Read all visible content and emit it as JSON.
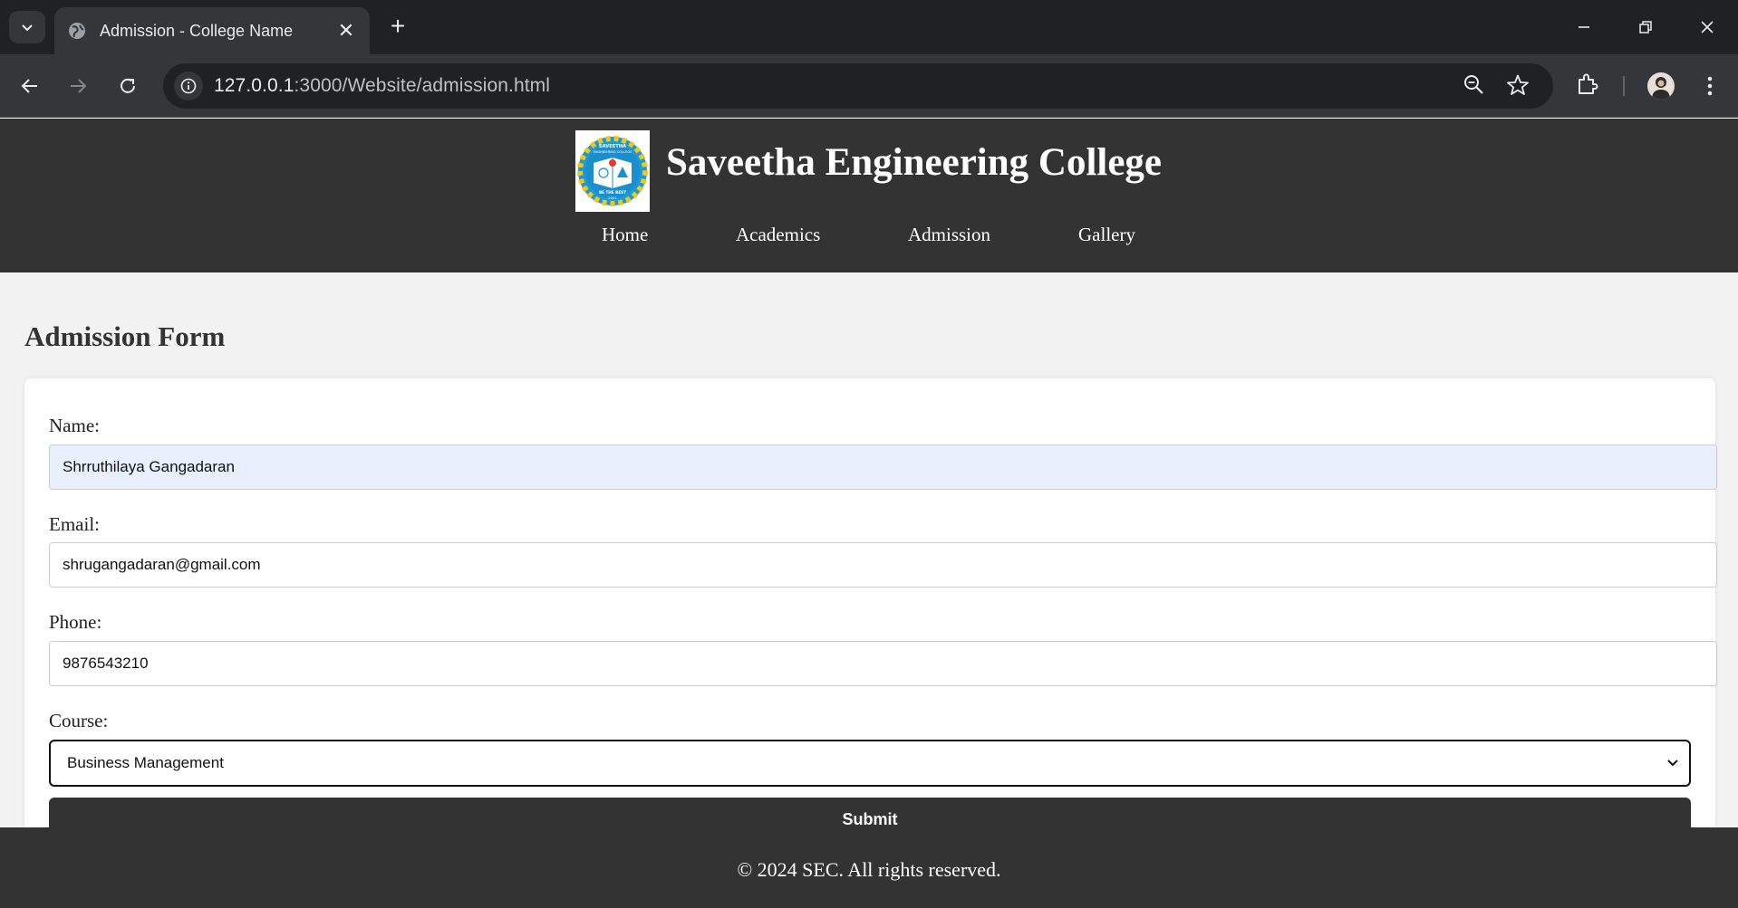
{
  "browser": {
    "tab_title": "Admission - College Name",
    "url_host": "127.0.0.1",
    "url_path": ":3000/Website/admission.html",
    "icons": [
      "tab-search-icon",
      "globe-icon",
      "close-icon",
      "new-tab-icon",
      "minimize-icon",
      "restore-icon",
      "window-close-icon",
      "back-icon",
      "forward-icon",
      "reload-icon",
      "site-info-icon",
      "zoom-icon",
      "bookmark-star-icon",
      "extensions-icon",
      "profile-avatar",
      "menu-kebab-icon"
    ],
    "new_tab_glyph": "+",
    "close_glyph": "✕"
  },
  "site": {
    "title": "Saveetha Engineering College",
    "logo": {
      "text_top": "SAVEETHA",
      "text_sub": "ENGINEERING COLLEGE",
      "motto": "BE THE BEST",
      "year": "2001"
    },
    "nav": [
      "Home",
      "Academics",
      "Admission",
      "Gallery"
    ]
  },
  "form": {
    "heading": "Admission Form",
    "name_label": "Name:",
    "name_value": "Shrruthilaya Gangadaran",
    "email_label": "Email:",
    "email_value": "shrugangadaran@gmail.com",
    "phone_label": "Phone:",
    "phone_value": "9876543210",
    "course_label": "Course:",
    "course_value": "Business Management",
    "submit_label": "Submit"
  },
  "footer": {
    "text": "© 2024 SEC. All rights reserved."
  },
  "colors": {
    "header_bg": "#333333",
    "page_bg": "#f2f2f2",
    "autofill_bg": "#e8f0fe",
    "chrome_dark": "#202124",
    "chrome_tab": "#35363a"
  }
}
